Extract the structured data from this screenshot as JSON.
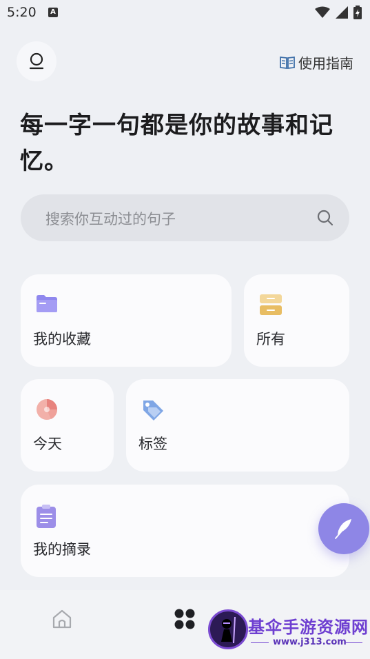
{
  "status_bar": {
    "time": "5:20",
    "a_badge": "A"
  },
  "header": {
    "guide_label": "使用指南"
  },
  "headline": "每一字一句都是你的故事和记忆。",
  "search": {
    "placeholder": "搜索你互动过的句子"
  },
  "cards": {
    "favorites": "我的收藏",
    "all": "所有",
    "today": "今天",
    "tags": "标签",
    "excerpts": "我的摘录"
  },
  "watermark": {
    "title": "基伞手游资源网",
    "url": "www.j313.com"
  },
  "colors": {
    "accent": "#8e86e6",
    "folder": "#8f87ee",
    "card_all": "#f0cc7f",
    "pie": "#e7837e",
    "tag": "#7fa6e5",
    "clipboard": "#9c8ee8"
  }
}
